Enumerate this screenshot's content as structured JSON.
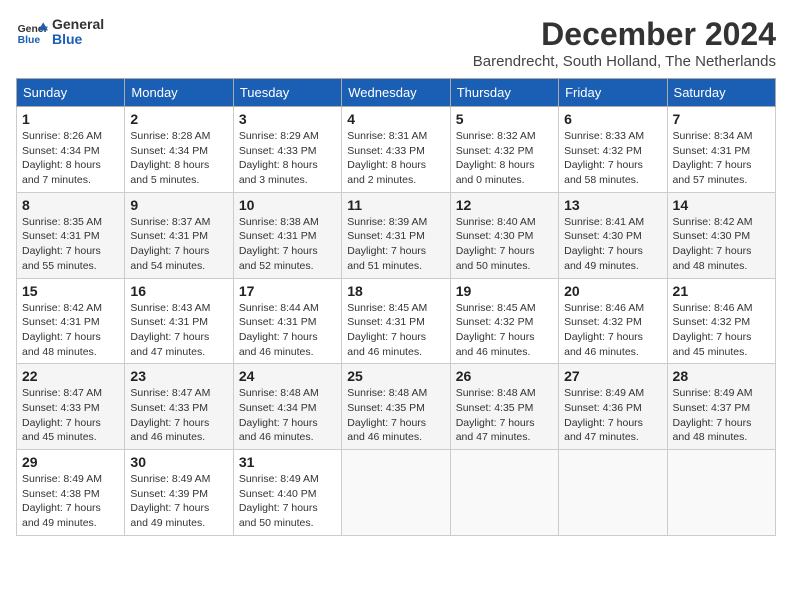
{
  "logo": {
    "text1": "General",
    "text2": "Blue"
  },
  "title": "December 2024",
  "location": "Barendrecht, South Holland, The Netherlands",
  "weekdays": [
    "Sunday",
    "Monday",
    "Tuesday",
    "Wednesday",
    "Thursday",
    "Friday",
    "Saturday"
  ],
  "weeks": [
    [
      {
        "day": 1,
        "sunrise": "8:26 AM",
        "sunset": "4:34 PM",
        "daylight": "8 hours and 7 minutes."
      },
      {
        "day": 2,
        "sunrise": "8:28 AM",
        "sunset": "4:34 PM",
        "daylight": "8 hours and 5 minutes."
      },
      {
        "day": 3,
        "sunrise": "8:29 AM",
        "sunset": "4:33 PM",
        "daylight": "8 hours and 3 minutes."
      },
      {
        "day": 4,
        "sunrise": "8:31 AM",
        "sunset": "4:33 PM",
        "daylight": "8 hours and 2 minutes."
      },
      {
        "day": 5,
        "sunrise": "8:32 AM",
        "sunset": "4:32 PM",
        "daylight": "8 hours and 0 minutes."
      },
      {
        "day": 6,
        "sunrise": "8:33 AM",
        "sunset": "4:32 PM",
        "daylight": "7 hours and 58 minutes."
      },
      {
        "day": 7,
        "sunrise": "8:34 AM",
        "sunset": "4:31 PM",
        "daylight": "7 hours and 57 minutes."
      }
    ],
    [
      {
        "day": 8,
        "sunrise": "8:35 AM",
        "sunset": "4:31 PM",
        "daylight": "7 hours and 55 minutes."
      },
      {
        "day": 9,
        "sunrise": "8:37 AM",
        "sunset": "4:31 PM",
        "daylight": "7 hours and 54 minutes."
      },
      {
        "day": 10,
        "sunrise": "8:38 AM",
        "sunset": "4:31 PM",
        "daylight": "7 hours and 52 minutes."
      },
      {
        "day": 11,
        "sunrise": "8:39 AM",
        "sunset": "4:31 PM",
        "daylight": "7 hours and 51 minutes."
      },
      {
        "day": 12,
        "sunrise": "8:40 AM",
        "sunset": "4:30 PM",
        "daylight": "7 hours and 50 minutes."
      },
      {
        "day": 13,
        "sunrise": "8:41 AM",
        "sunset": "4:30 PM",
        "daylight": "7 hours and 49 minutes."
      },
      {
        "day": 14,
        "sunrise": "8:42 AM",
        "sunset": "4:30 PM",
        "daylight": "7 hours and 48 minutes."
      }
    ],
    [
      {
        "day": 15,
        "sunrise": "8:42 AM",
        "sunset": "4:31 PM",
        "daylight": "7 hours and 48 minutes."
      },
      {
        "day": 16,
        "sunrise": "8:43 AM",
        "sunset": "4:31 PM",
        "daylight": "7 hours and 47 minutes."
      },
      {
        "day": 17,
        "sunrise": "8:44 AM",
        "sunset": "4:31 PM",
        "daylight": "7 hours and 46 minutes."
      },
      {
        "day": 18,
        "sunrise": "8:45 AM",
        "sunset": "4:31 PM",
        "daylight": "7 hours and 46 minutes."
      },
      {
        "day": 19,
        "sunrise": "8:45 AM",
        "sunset": "4:32 PM",
        "daylight": "7 hours and 46 minutes."
      },
      {
        "day": 20,
        "sunrise": "8:46 AM",
        "sunset": "4:32 PM",
        "daylight": "7 hours and 46 minutes."
      },
      {
        "day": 21,
        "sunrise": "8:46 AM",
        "sunset": "4:32 PM",
        "daylight": "7 hours and 45 minutes."
      }
    ],
    [
      {
        "day": 22,
        "sunrise": "8:47 AM",
        "sunset": "4:33 PM",
        "daylight": "7 hours and 45 minutes."
      },
      {
        "day": 23,
        "sunrise": "8:47 AM",
        "sunset": "4:33 PM",
        "daylight": "7 hours and 46 minutes."
      },
      {
        "day": 24,
        "sunrise": "8:48 AM",
        "sunset": "4:34 PM",
        "daylight": "7 hours and 46 minutes."
      },
      {
        "day": 25,
        "sunrise": "8:48 AM",
        "sunset": "4:35 PM",
        "daylight": "7 hours and 46 minutes."
      },
      {
        "day": 26,
        "sunrise": "8:48 AM",
        "sunset": "4:35 PM",
        "daylight": "7 hours and 47 minutes."
      },
      {
        "day": 27,
        "sunrise": "8:49 AM",
        "sunset": "4:36 PM",
        "daylight": "7 hours and 47 minutes."
      },
      {
        "day": 28,
        "sunrise": "8:49 AM",
        "sunset": "4:37 PM",
        "daylight": "7 hours and 48 minutes."
      }
    ],
    [
      {
        "day": 29,
        "sunrise": "8:49 AM",
        "sunset": "4:38 PM",
        "daylight": "7 hours and 49 minutes."
      },
      {
        "day": 30,
        "sunrise": "8:49 AM",
        "sunset": "4:39 PM",
        "daylight": "7 hours and 49 minutes."
      },
      {
        "day": 31,
        "sunrise": "8:49 AM",
        "sunset": "4:40 PM",
        "daylight": "7 hours and 50 minutes."
      },
      null,
      null,
      null,
      null
    ]
  ]
}
